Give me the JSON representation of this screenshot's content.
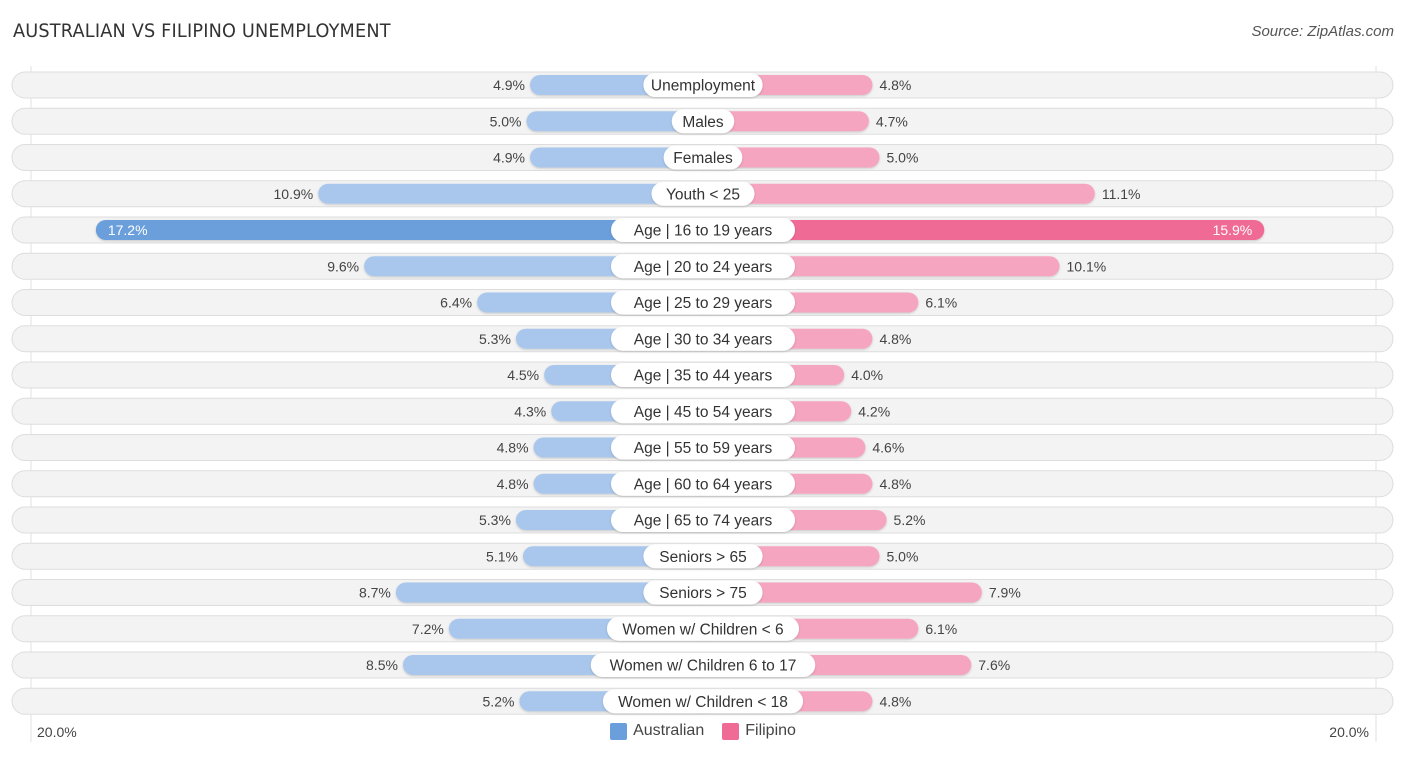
{
  "header": {
    "title": "AUSTRALIAN VS FILIPINO UNEMPLOYMENT",
    "source": "Source: ZipAtlas.com"
  },
  "legend": {
    "items": [
      {
        "label": "Australian",
        "color": "#6a9fdc"
      },
      {
        "label": "Filipino",
        "color": "#f06a96"
      }
    ]
  },
  "axis": {
    "left_label": "20.0%",
    "right_label": "20.0%"
  },
  "colors": {
    "australian_light": "#a9c7ec",
    "australian_strong": "#6a9fdc",
    "filipino_light": "#f5a5bf",
    "filipino_strong": "#f06a96",
    "row_bg": "#f3f3f3",
    "row_border": "#dddddd"
  },
  "chart_data": {
    "type": "bar",
    "orientation": "diverging-horizontal",
    "title": "AUSTRALIAN VS FILIPINO UNEMPLOYMENT",
    "xlim": [
      -20,
      20
    ],
    "unit": "%",
    "categories": [
      "Unemployment",
      "Males",
      "Females",
      "Youth < 25",
      "Age | 16 to 19 years",
      "Age | 20 to 24 years",
      "Age | 25 to 29 years",
      "Age | 30 to 34 years",
      "Age | 35 to 44 years",
      "Age | 45 to 54 years",
      "Age | 55 to 59 years",
      "Age | 60 to 64 years",
      "Age | 65 to 74 years",
      "Seniors > 65",
      "Seniors > 75",
      "Women w/ Children < 6",
      "Women w/ Children 6 to 17",
      "Women w/ Children < 18"
    ],
    "series": [
      {
        "name": "Australian",
        "side": "left",
        "values": [
          4.9,
          5.0,
          4.9,
          10.9,
          17.2,
          9.6,
          6.4,
          5.3,
          4.5,
          4.3,
          4.8,
          4.8,
          5.3,
          5.1,
          8.7,
          7.2,
          8.5,
          5.2
        ],
        "labels": [
          "4.9%",
          "5.0%",
          "4.9%",
          "10.9%",
          "17.2%",
          "9.6%",
          "6.4%",
          "5.3%",
          "4.5%",
          "4.3%",
          "4.8%",
          "4.8%",
          "5.3%",
          "5.1%",
          "8.7%",
          "7.2%",
          "8.5%",
          "5.2%"
        ]
      },
      {
        "name": "Filipino",
        "side": "right",
        "values": [
          4.8,
          4.7,
          5.0,
          11.1,
          15.9,
          10.1,
          6.1,
          4.8,
          4.0,
          4.2,
          4.6,
          4.8,
          5.2,
          5.0,
          7.9,
          6.1,
          7.6,
          4.8
        ],
        "labels": [
          "4.8%",
          "4.7%",
          "5.0%",
          "11.1%",
          "15.9%",
          "10.1%",
          "6.1%",
          "4.8%",
          "4.0%",
          "4.2%",
          "4.6%",
          "4.8%",
          "5.2%",
          "5.0%",
          "7.9%",
          "6.1%",
          "7.6%",
          "4.8%"
        ]
      }
    ],
    "legend_position": "bottom-center",
    "xlabel": "",
    "ylabel": ""
  }
}
